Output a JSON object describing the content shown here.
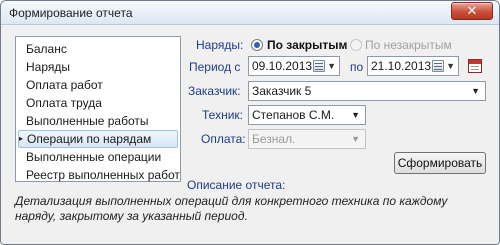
{
  "window": {
    "title": "Формирование отчета",
    "close_glyph": "✕"
  },
  "report_list": {
    "items": [
      {
        "label": "Баланс",
        "selected": false
      },
      {
        "label": "Наряды",
        "selected": false
      },
      {
        "label": "Оплата работ",
        "selected": false
      },
      {
        "label": "Оплата труда",
        "selected": false
      },
      {
        "label": "Выполненные работы",
        "selected": false
      },
      {
        "label": "Операции по нарядам",
        "selected": true
      },
      {
        "label": "Выполненные операции",
        "selected": false
      },
      {
        "label": "Реестр выполненных работ",
        "selected": false
      }
    ],
    "selected_marker": "▸"
  },
  "form": {
    "orders_label": "Наряды:",
    "radio_closed_label": "По закрытым",
    "radio_open_label": "По незакрытым",
    "period_from_label": "Период с",
    "period_to_label": "по",
    "date_from": "09.10.2013",
    "date_to": "21.10.2013",
    "customer_label": "Заказчик:",
    "customer_value": "Заказчик 5",
    "technician_label": "Техник:",
    "technician_value": "Степанов С.М.",
    "payment_label": "Оплата:",
    "payment_value": "Безнал.",
    "dropdown_arrow": "▼",
    "generate_button": "Сформировать"
  },
  "description": {
    "title": "Описание отчета:",
    "text": "Детализация выполненных операций для конкретного техника по каждому наряду, закрытому за указанный период."
  },
  "colors": {
    "label_blue": "#1f3c88",
    "close_red": "#c9503a",
    "selection_blue": "#d5e5f7"
  }
}
